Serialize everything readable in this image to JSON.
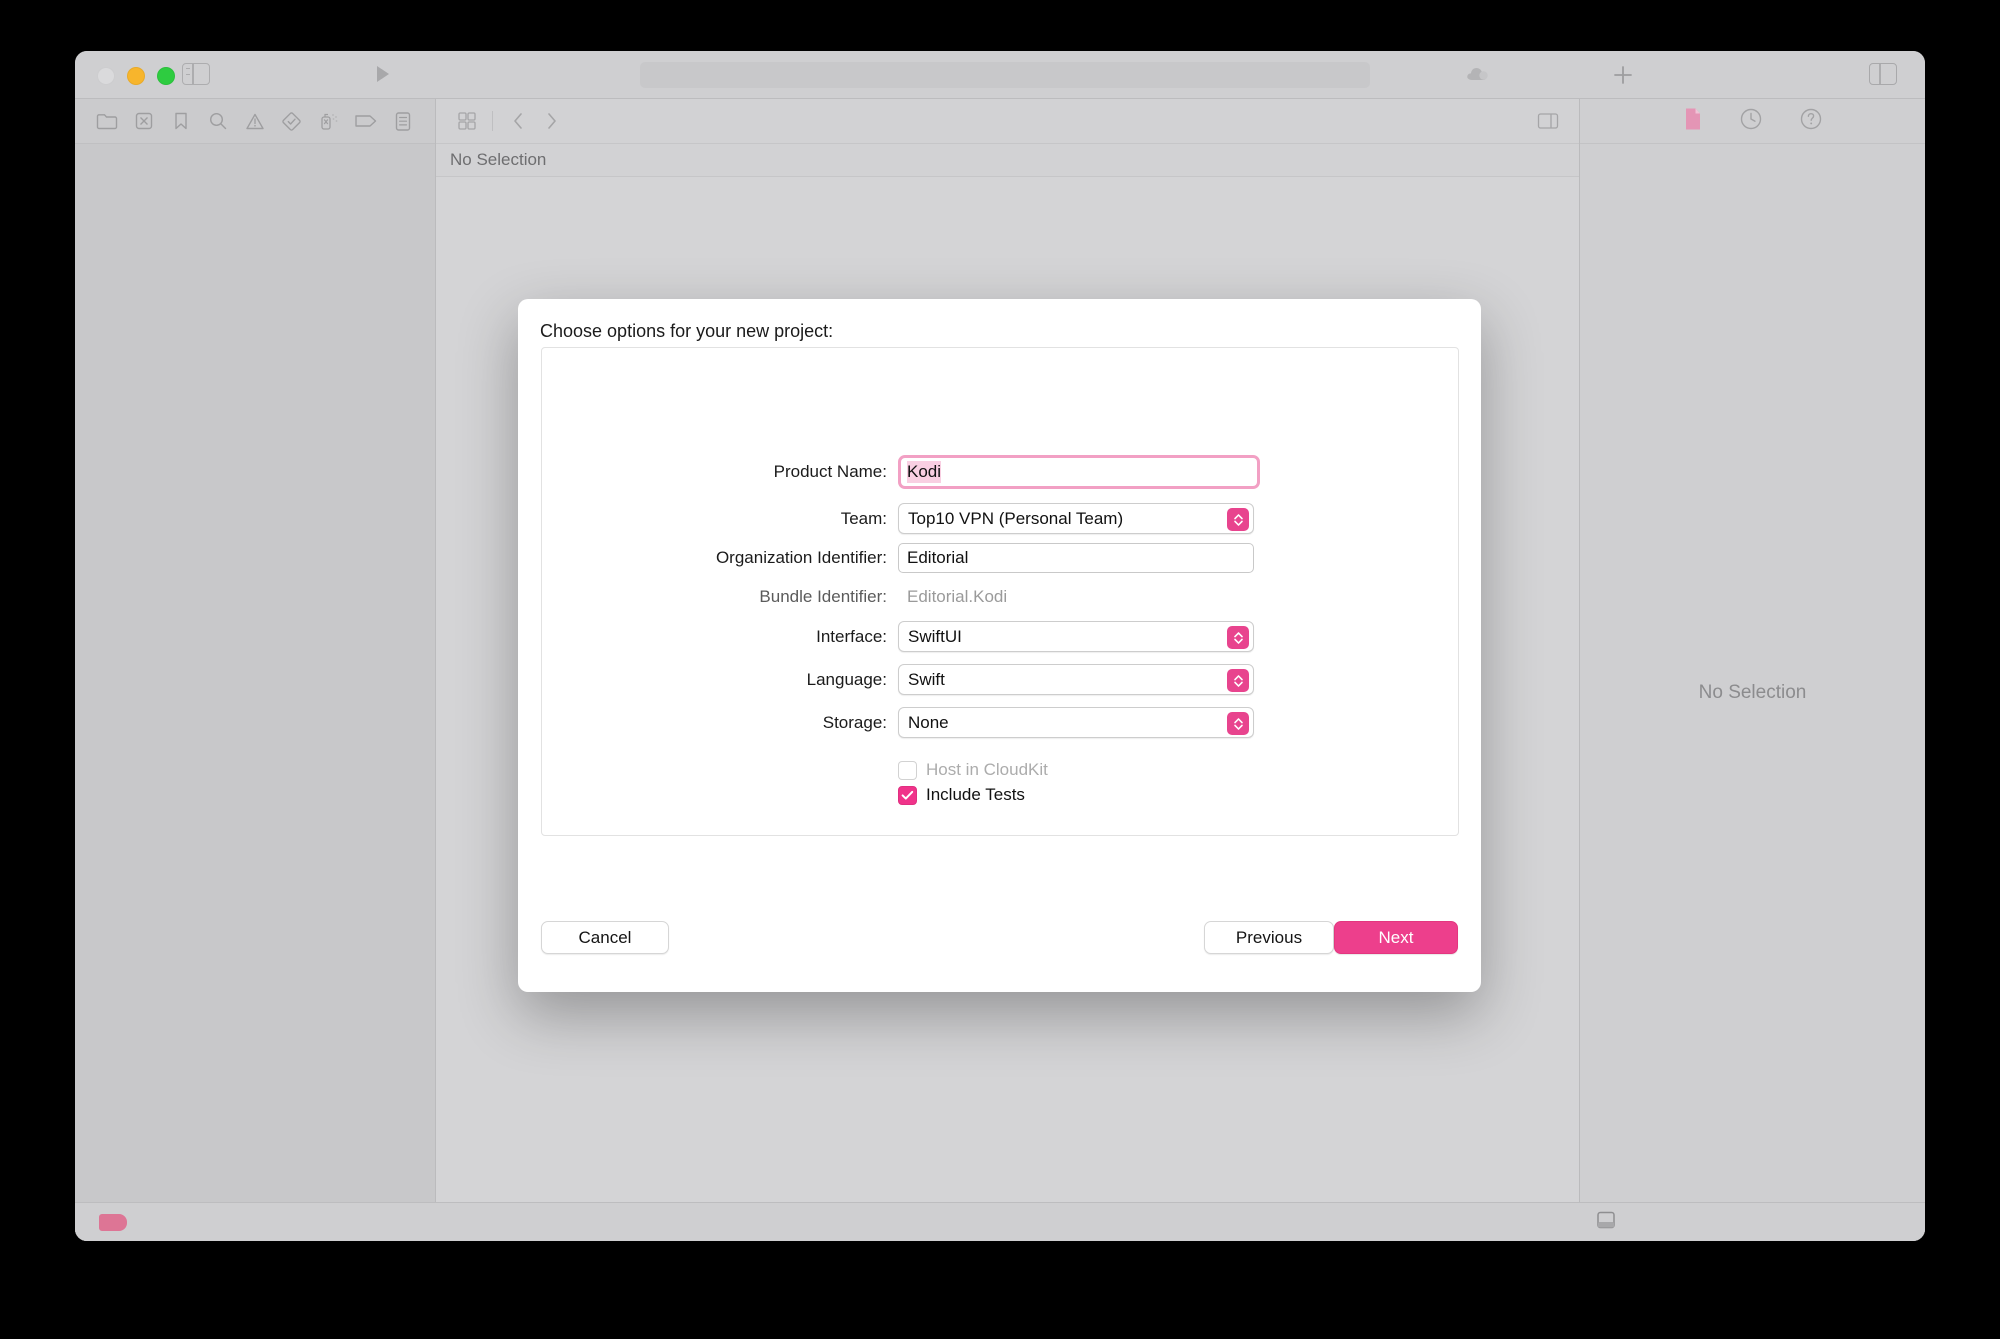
{
  "window": {
    "traffic_lights": [
      "close",
      "minimize",
      "maximize"
    ],
    "toolbar": {
      "sidebar_toggle_icon": "sidebar-left-icon",
      "run_icon": "run-play-icon",
      "cloud_icon": "cloud-icon",
      "add_icon": "plus-icon",
      "inspector_toggle_icon": "sidebar-right-icon"
    }
  },
  "navigator": {
    "icons": [
      {
        "name": "folder-icon",
        "label": "Project navigator"
      },
      {
        "name": "source-control-icon",
        "label": "Source control navigator"
      },
      {
        "name": "bookmark-icon",
        "label": "Bookmark navigator"
      },
      {
        "name": "search-icon",
        "label": "Find navigator"
      },
      {
        "name": "warning-triangle-icon",
        "label": "Issue navigator"
      },
      {
        "name": "test-diamond-icon",
        "label": "Test navigator"
      },
      {
        "name": "debug-spray-icon",
        "label": "Debug navigator"
      },
      {
        "name": "tag-icon",
        "label": "Breakpoint navigator"
      },
      {
        "name": "report-list-icon",
        "label": "Report navigator"
      }
    ]
  },
  "editor": {
    "icons": [
      {
        "name": "editor-layout-icon",
        "label": "Editor options"
      },
      {
        "name": "chevron-left-icon",
        "label": "Back"
      },
      {
        "name": "chevron-right-icon",
        "label": "Forward"
      },
      {
        "name": "editor-split-icon",
        "label": "Add editor"
      }
    ],
    "jumpbar_text": "No Selection"
  },
  "inspector": {
    "icons": [
      {
        "name": "file-inspector-icon",
        "label": "File inspector"
      },
      {
        "name": "history-clock-icon",
        "label": "History inspector"
      },
      {
        "name": "help-question-icon",
        "label": "Quick Help inspector"
      }
    ],
    "empty_text": "No Selection"
  },
  "statusbar": {
    "tag_badge_name": "pink-tag-badge",
    "console_toggle_icon": "console-toggle-icon"
  },
  "sheet": {
    "title": "Choose options for your new project:",
    "fields": [
      {
        "id": "product-name",
        "label": "Product Name:",
        "value": "Kodi",
        "type": "text",
        "focused": true,
        "selected": true
      },
      {
        "id": "team",
        "label": "Team:",
        "value": "Top10 VPN (Personal Team)",
        "type": "popup"
      },
      {
        "id": "organization-identifier",
        "label": "Organization Identifier:",
        "value": "Editorial",
        "type": "text",
        "focused": false
      },
      {
        "id": "bundle-identifier",
        "label": "Bundle Identifier:",
        "value": "Editorial.Kodi",
        "type": "static",
        "dim": true
      },
      {
        "id": "interface",
        "label": "Interface:",
        "value": "SwiftUI",
        "type": "popup"
      },
      {
        "id": "language",
        "label": "Language:",
        "value": "Swift",
        "type": "popup"
      },
      {
        "id": "storage",
        "label": "Storage:",
        "value": "None",
        "type": "popup"
      }
    ],
    "checkboxes": [
      {
        "id": "host-in-cloudkit",
        "label": "Host in CloudKit",
        "checked": false,
        "enabled": false
      },
      {
        "id": "include-tests",
        "label": "Include Tests",
        "checked": true,
        "enabled": true
      }
    ],
    "buttons": {
      "cancel": "Cancel",
      "previous": "Previous",
      "next": "Next"
    }
  },
  "colors": {
    "accent_pink": "#ed3f8c",
    "focus_ring_pink": "#f2a0c4",
    "selection_pink": "#f9cfe2",
    "checkbox_pink": "#f0338a",
    "window_gray": "#d0d0d2",
    "traffic_yellow": "#f7b52c",
    "traffic_green": "#2ecc40"
  }
}
